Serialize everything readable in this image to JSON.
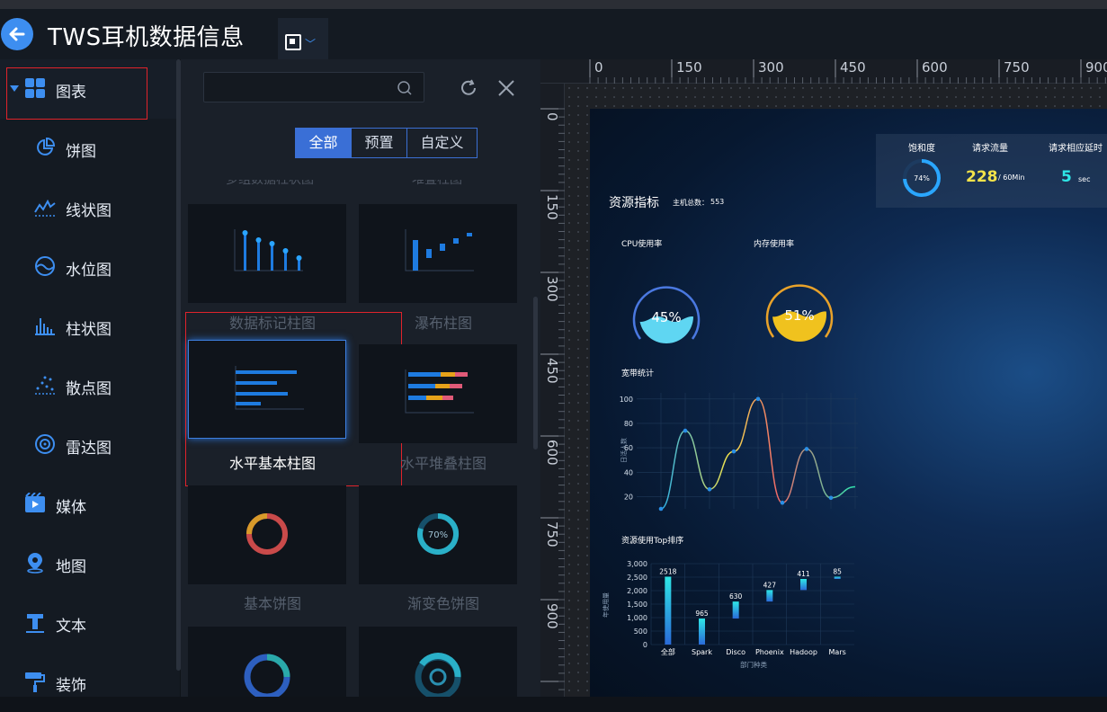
{
  "header": {
    "title": "TWS耳机数据信息"
  },
  "sidebar": {
    "items": [
      {
        "label": "图表",
        "icon": "grid-icon",
        "level": "top",
        "expanded": true
      },
      {
        "label": "饼图",
        "icon": "pie-icon",
        "level": "sub"
      },
      {
        "label": "线状图",
        "icon": "line-chart-icon",
        "level": "sub"
      },
      {
        "label": "水位图",
        "icon": "wave-icon",
        "level": "sub"
      },
      {
        "label": "柱状图",
        "icon": "bar-chart-icon",
        "level": "sub"
      },
      {
        "label": "散点图",
        "icon": "scatter-icon",
        "level": "sub"
      },
      {
        "label": "雷达图",
        "icon": "radar-icon",
        "level": "sub"
      },
      {
        "label": "媒体",
        "icon": "media-icon",
        "level": "top"
      },
      {
        "label": "地图",
        "icon": "map-pin-icon",
        "level": "top"
      },
      {
        "label": "文本",
        "icon": "text-icon",
        "level": "top"
      },
      {
        "label": "装饰",
        "icon": "paint-roller-icon",
        "level": "top"
      }
    ]
  },
  "panel": {
    "search_placeholder": "",
    "filters": [
      "全部",
      "预置",
      "自定义"
    ],
    "active_filter": "全部",
    "clipped_labels": [
      "多组数据柱状图",
      "堆叠柱图"
    ],
    "thumbnails": [
      {
        "label": "数据标记柱图",
        "selected": false
      },
      {
        "label": "瀑布柱图",
        "selected": false
      },
      {
        "label": "水平基本柱图",
        "selected": true
      },
      {
        "label": "水平堆叠柱图",
        "selected": false
      },
      {
        "label": "基本饼图",
        "selected": false
      },
      {
        "label": "渐变色饼图",
        "selected": false,
        "center_text": "70%"
      }
    ]
  },
  "ruler": {
    "top": [
      "0",
      "150",
      "300",
      "450",
      "600",
      "750",
      "900"
    ],
    "left": [
      "0",
      "150",
      "300",
      "450",
      "600",
      "750",
      "900"
    ]
  },
  "screen": {
    "kpis": {
      "saturation": {
        "label": "饱和度",
        "value": "74%"
      },
      "traffic": {
        "label": "请求流量",
        "value": "228",
        "unit": "/ 60Min"
      },
      "latency": {
        "label": "请求相应延时",
        "value": "5",
        "unit": "sec"
      }
    },
    "resources": {
      "title": "资源指标",
      "host_label": "主机总数：",
      "host_count": "553"
    },
    "cpu": {
      "label": "CPU使用率",
      "value": "45%",
      "fill": 0.45
    },
    "memory": {
      "label": "内存使用率",
      "value": "51%",
      "fill": 0.51
    },
    "bandwidth": {
      "title": "宽带统计",
      "ylabel": "日活人数"
    },
    "top_rank": {
      "title": "资源使用Top排序",
      "xlabel": "部门种类",
      "ylabel": "年使用量"
    }
  },
  "chart_data": [
    {
      "type": "line",
      "title": "宽带统计",
      "ylabel": "日活人数",
      "yticks": [
        20,
        40,
        60,
        80,
        100
      ],
      "ylim": [
        10,
        105
      ],
      "x": [
        0,
        1,
        2,
        3,
        4,
        5,
        6,
        7,
        8
      ],
      "values": [
        10,
        74,
        26,
        57,
        100,
        15,
        59,
        19,
        28
      ]
    },
    {
      "type": "bar",
      "title": "资源使用Top排序",
      "xlabel": "部门种类",
      "ylabel": "年使用量",
      "yticks": [
        "0",
        "500",
        "1,000",
        "1,500",
        "2,000",
        "2,500",
        "3,000"
      ],
      "ylim": [
        0,
        3000
      ],
      "categories": [
        "全部",
        "Spark",
        "Disco",
        "Phoenix",
        "Hadoop",
        "Mars"
      ],
      "values": [
        2518,
        965,
        630,
        427,
        411,
        85
      ],
      "bases": [
        0,
        0,
        965,
        1595,
        2022,
        2433
      ]
    }
  ]
}
